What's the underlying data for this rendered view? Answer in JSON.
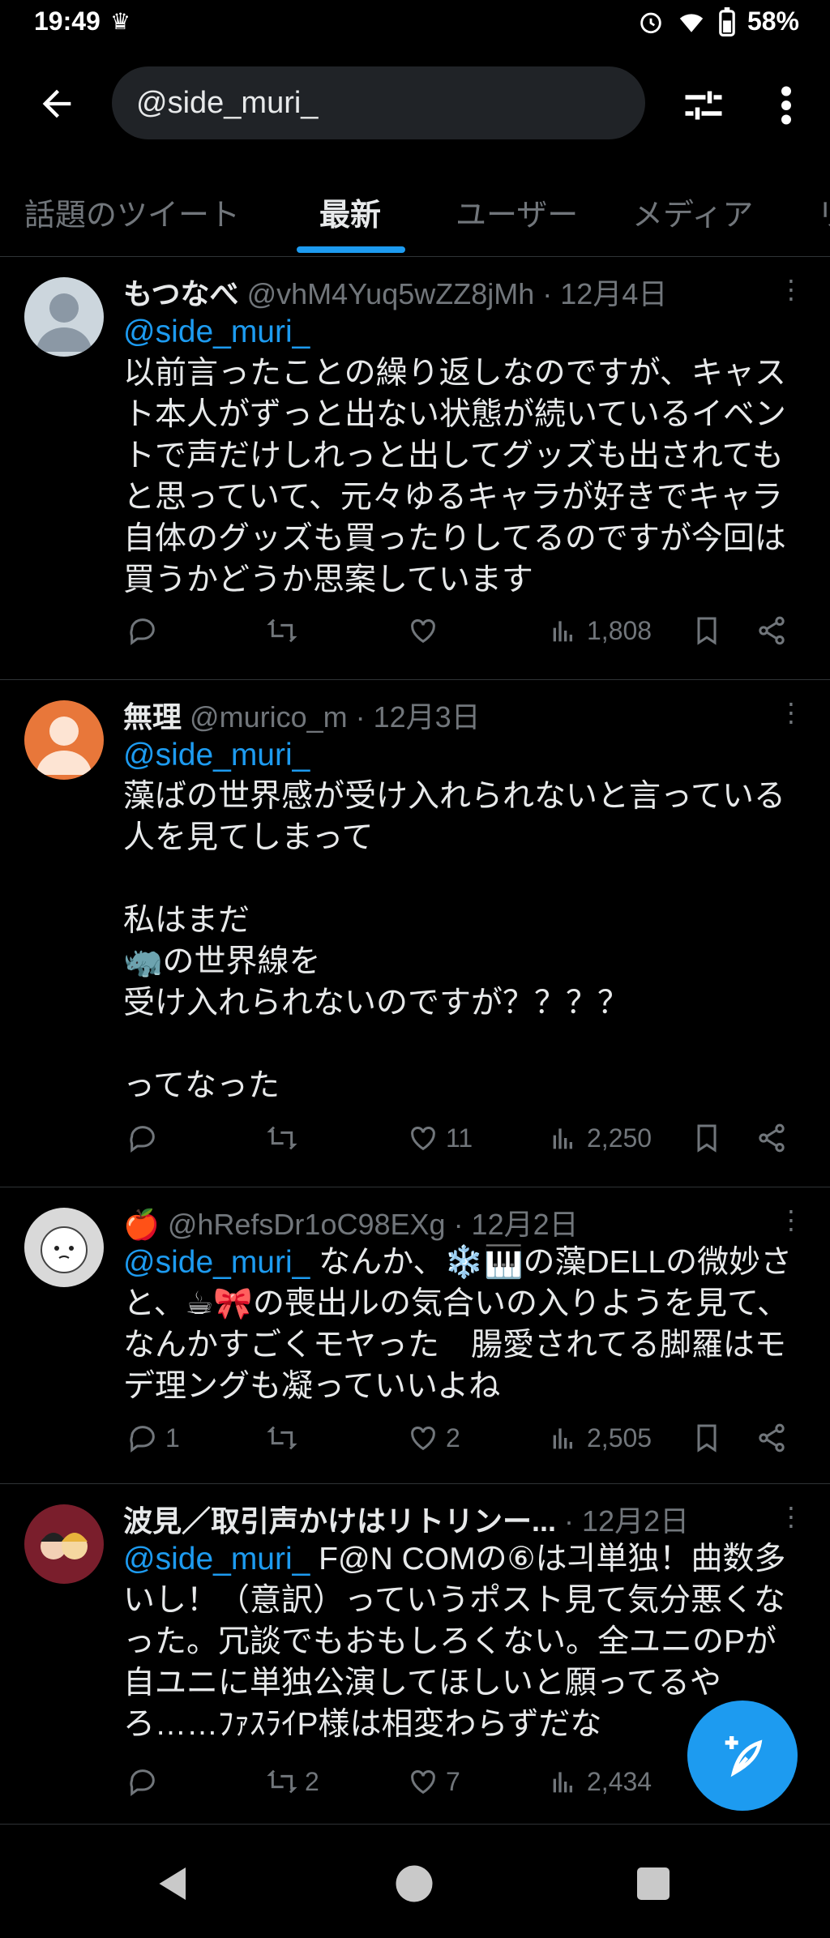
{
  "status": {
    "time": "19:49",
    "battery": "58%"
  },
  "search": {
    "query": "@side_muri_"
  },
  "tabs": [
    "話題のツイート",
    "最新",
    "ユーザー",
    "メディア",
    "リ"
  ],
  "tweets": [
    {
      "name": "もつなべ",
      "handle": "@vhM4Yuq5wZZ8jMh",
      "date": "· 12月4日",
      "mention": "@side_muri_",
      "text": "以前言ったことの繰り返しなのですが、キャスト本人がずっと出ない状態が続いているイベントで声だけしれっと出してグッズも出されてもと思っていて、元々ゆるキャラが好きでキャラ自体のグッズも買ったりしてるのですが今回は買うかどうか思案しています",
      "replies": "",
      "retweets": "",
      "likes": "",
      "views": "1,808"
    },
    {
      "name": "無理",
      "handle": "@murico_m",
      "date": "· 12月3日",
      "mention": "@side_muri_",
      "text": "藻ばの世界感が受け入れられないと言っている人を見てしまって\n\n私はまだ\n🦏の世界線を\n受け入れられないのですが？？？？\n\nってなった",
      "replies": "",
      "retweets": "",
      "likes": "11",
      "views": "2,250"
    },
    {
      "name": "🍎",
      "handle": "@hRefsDr1oC98EXg",
      "date": "· 12月2日",
      "mention": "@side_muri_",
      "text": " なんか、❄️🎹の藻DELLの微妙さと、☕🎀の喪出ルの気合いの入りようを見て、なんかすごくモヤった　腸愛されてる脚羅はモデ理ングも凝っていいよね",
      "replies": "1",
      "retweets": "",
      "likes": "2",
      "views": "2,505"
    },
    {
      "name": "波見／取引声かけはリトリンー...",
      "handle": "",
      "date": "· 12月2日",
      "mention": "@side_muri_",
      "text": " F@N COMの⑥は긔単独！曲数多いし！（意訳）っていうポスト見て気分悪くなった。冗談でもおもしろくない。全ユニのPが自ユニに単独公演してほしいと願ってるやろ……ﾌｧｽﾗｲP様は相変わらずだな",
      "replies": "",
      "retweets": "2",
      "likes": "7",
      "views": "2,434"
    }
  ],
  "colors": {
    "accent": "#1d9bf0",
    "background": "#000000",
    "muted": "#71767b"
  }
}
